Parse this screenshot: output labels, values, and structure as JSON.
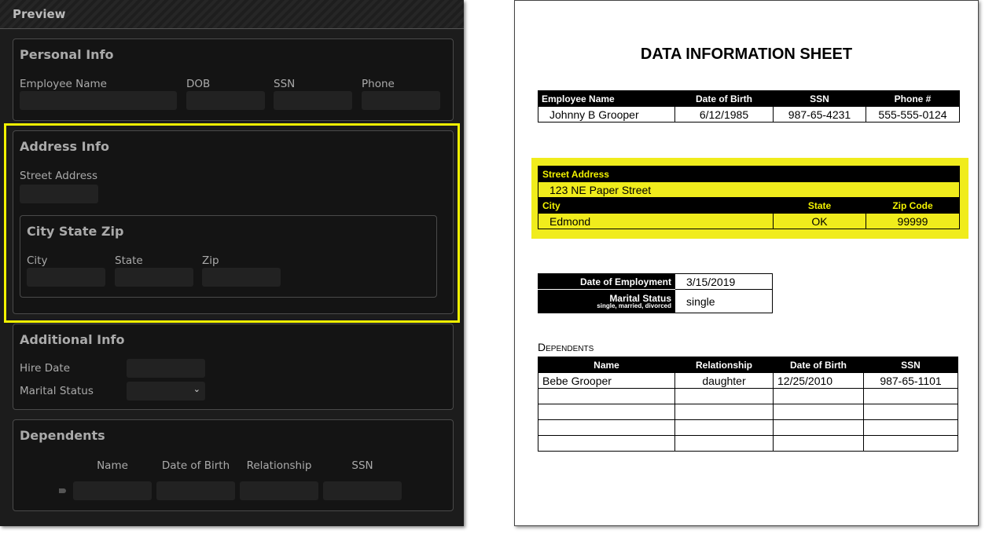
{
  "panel": {
    "title": "Preview"
  },
  "personal": {
    "title": "Personal Info",
    "labels": [
      "Employee Name",
      "DOB",
      "SSN",
      "Phone"
    ]
  },
  "address": {
    "title": "Address Info",
    "street_label": "Street Address",
    "csz": {
      "title": "City State Zip",
      "labels": [
        "City",
        "State",
        "Zip"
      ]
    }
  },
  "additional": {
    "title": "Additional Info",
    "hire_label": "Hire Date",
    "marital_label": "Marital Status",
    "marital_value": ""
  },
  "dependents": {
    "title": "Dependents",
    "labels": [
      "Name",
      "Date of Birth",
      "Relationship",
      "SSN"
    ]
  },
  "sheet": {
    "title": "DATA INFORMATION SHEET",
    "personal": {
      "headers": [
        "Employee Name",
        "Date of Birth",
        "SSN",
        "Phone #"
      ],
      "values": [
        "Johnny B Grooper",
        "6/12/1985",
        "987-65-4231",
        "555-555-0124"
      ]
    },
    "address": {
      "street_header": "Street Address",
      "street": "123 NE Paper Street",
      "headers": [
        "City",
        "State",
        "Zip Code"
      ],
      "values": [
        "Edmond",
        "OK",
        "99999"
      ]
    },
    "employment": {
      "doe_label": "Date of Employment",
      "doe": "3/15/2019",
      "ms_label": "Marital Status",
      "ms_hint": "single, married, divorced",
      "ms": "single"
    },
    "dependents": {
      "title": "Dependents",
      "headers": [
        "Name",
        "Relationship",
        "Date of Birth",
        "SSN"
      ],
      "rows": [
        [
          "Bebe Grooper",
          "daughter",
          "12/25/2010",
          "987-65-1101"
        ]
      ]
    }
  },
  "colors": {
    "highlight": "#f2f200"
  }
}
